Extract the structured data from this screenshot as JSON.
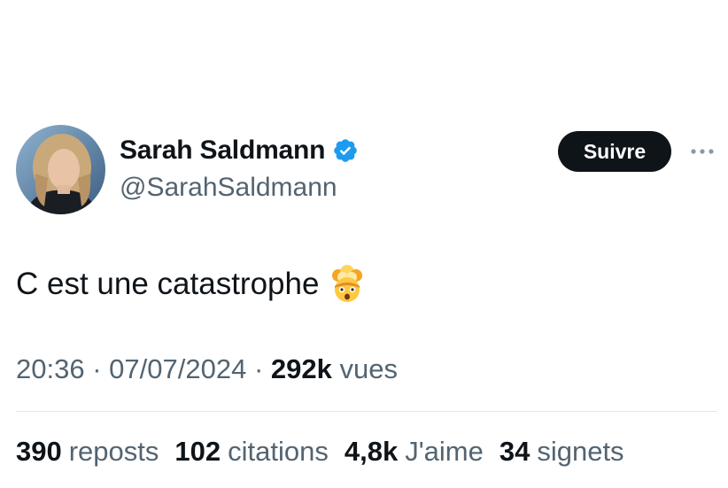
{
  "author": {
    "display_name": "Sarah Saldmann",
    "handle": "@SarahSaldmann",
    "verified": true,
    "verified_color": "#1d9bf0"
  },
  "follow_button": {
    "label": "Suivre"
  },
  "more_button": {
    "icon": "more-horizontal-icon"
  },
  "tweet": {
    "text": "C est une catastrophe",
    "emoji": "exploding-head-icon"
  },
  "meta": {
    "time": "20:36",
    "separator": "·",
    "date": "07/07/2024",
    "views_count": "292k",
    "views_label": "vues"
  },
  "stats": [
    {
      "count": "390",
      "label": "reposts"
    },
    {
      "count": "102",
      "label": "citations"
    },
    {
      "count": "4,8k",
      "label": "J'aime"
    },
    {
      "count": "34",
      "label": "signets"
    }
  ],
  "colors": {
    "text_primary": "#0f1419",
    "text_secondary": "#536471",
    "follow_bg": "#0f1419",
    "divider": "#e1e8ed"
  }
}
